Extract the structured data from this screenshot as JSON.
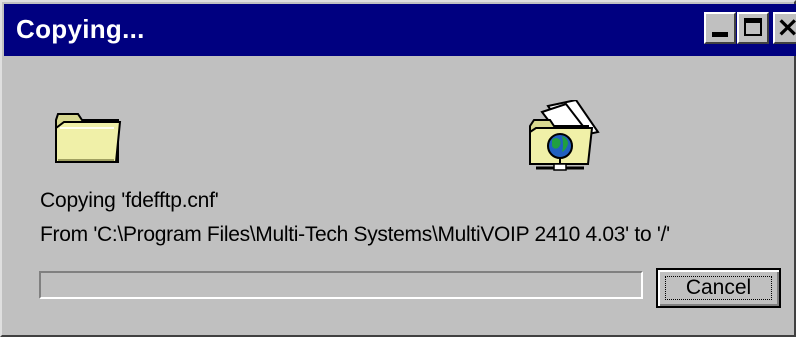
{
  "window": {
    "title": "Copying..."
  },
  "titlebar_buttons": {
    "minimize": "minimize",
    "maximize": "maximize",
    "close": "close"
  },
  "icons": {
    "source": "folder-icon",
    "destination": "network-folder-icon"
  },
  "message": {
    "line1": "Copying 'fdefftp.cnf'",
    "line2": "From 'C:\\Program Files\\Multi-Tech Systems\\MultiVOIP 2410 4.03' to '/'"
  },
  "progress": {
    "value": 0
  },
  "buttons": {
    "cancel": "Cancel"
  },
  "colors": {
    "titlebar": "#000080",
    "face": "#c0c0c0",
    "folder": "#f0f0a0"
  }
}
